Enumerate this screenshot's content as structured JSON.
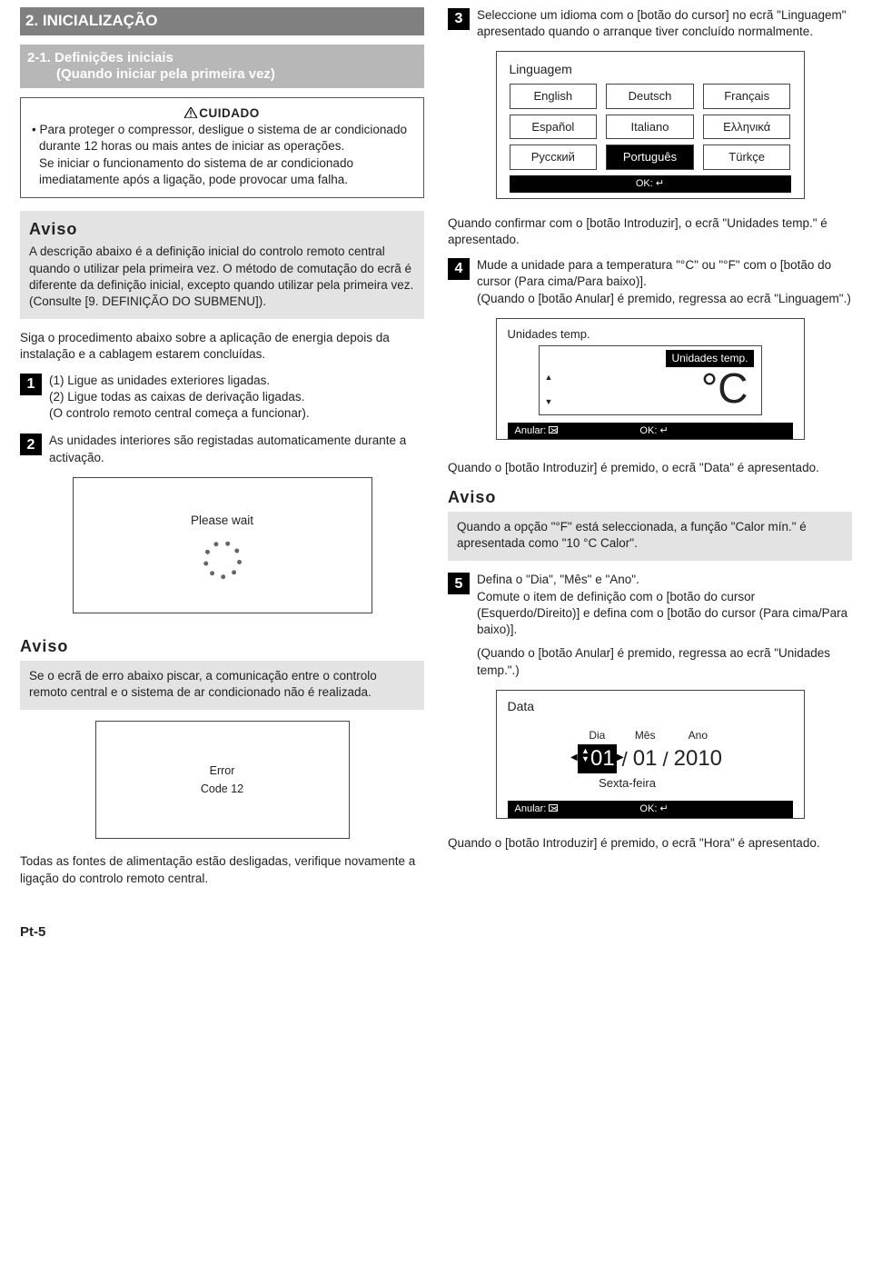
{
  "section": {
    "title": "2. INICIALIZAÇÃO",
    "subtitle_l1": "2-1. Definições iniciais",
    "subtitle_l2": "(Quando iniciar pela primeira vez)"
  },
  "caution": {
    "head": "CUIDADO",
    "p1": "• Para proteger o compressor, desligue o sistema de ar condicionado durante 12 horas ou mais antes de iniciar as operações.",
    "p2": "Se iniciar o funcionamento do sistema de ar condicionado imediatamente após a ligação, pode provocar uma falha."
  },
  "aviso1": {
    "head": "Aviso",
    "body": "A descrição abaixo é a definição inicial do controlo remoto central quando o utilizar pela primeira vez. O método de comutação do ecrã é diferente da definição inicial, excepto quando utilizar pela primeira vez. (Consulte [9. DEFINIÇÃO DO SUBMENU])."
  },
  "intro_follow": "Siga o procedimento abaixo sobre a aplicação de energia depois da instalação e a cablagem estarem concluídas.",
  "step1": {
    "n": "1",
    "l1": "(1) Ligue as unidades exteriores ligadas.",
    "l2": "(2) Ligue todas as caixas de derivação ligadas.",
    "l3": "(O controlo remoto central começa a funcionar)."
  },
  "step2": {
    "n": "2",
    "body": "As unidades interiores são registadas automaticamente durante a activação."
  },
  "wait_screen": {
    "text": "Please wait"
  },
  "aviso2": {
    "head": "Aviso",
    "body": "Se o ecrã de erro abaixo piscar, a comunicação entre o controlo remoto central e o sistema de ar condicionado não é realizada."
  },
  "error_screen": {
    "l1": "Error",
    "l2": "Code 12"
  },
  "after_error": "Todas as fontes de alimentação estão desligadas, verifique novamente a ligação do controlo remoto central.",
  "step3": {
    "n": "3",
    "body": "Seleccione um idioma com o [botão do cursor] no ecrã \"Linguagem\" apresentado quando o arranque tiver concluído normalmente."
  },
  "lang_screen": {
    "title": "Linguagem",
    "opts": [
      "English",
      "Deutsch",
      "Français",
      "Español",
      "Italiano",
      "Ελληνικά",
      "Русский",
      "Português",
      "Türkçe"
    ],
    "ok": "OK:"
  },
  "after_lang": "Quando confirmar com o [botão Introduzir], o ecrã \"Unidades temp.\" é apresentado.",
  "step4": {
    "n": "4",
    "l1": "Mude a unidade para a temperatura \"°C\" ou \"°F\" com o [botão do cursor (Para cima/Para baixo)].",
    "l2": "(Quando o [botão Anular] é premido, regressa ao ecrã \"Linguagem\".)"
  },
  "temp_screen": {
    "outer": "Unidades temp.",
    "inner": "Unidades temp.",
    "value": "°C",
    "cancel": "Anular:",
    "ok": "OK:"
  },
  "after_temp": "Quando o [botão Introduzir] é premido, o ecrã \"Data\" é apresentado.",
  "aviso3": {
    "head": "Aviso",
    "body": "Quando a opção \"°F\" está seleccionada, a função \"Calor mín.\" é apresentada como \"10 °C Calor\"."
  },
  "step5": {
    "n": "5",
    "l1": "Defina o \"Dia\", \"Mês\" e \"Ano\".",
    "l2": "Comute o item de definição com o [botão do cursor (Esquerdo/Direito)] e defina com o [botão do cursor (Para cima/Para baixo)].",
    "l3": "(Quando o [botão Anular] é premido, regressa ao ecrã \"Unidades temp.\".)"
  },
  "date_screen": {
    "title": "Data",
    "day_l": "Dia",
    "mon_l": "Mês",
    "year_l": "Ano",
    "day": "01",
    "mon": "01",
    "year": "2010",
    "weekday": "Sexta-feira",
    "cancel": "Anular:",
    "ok": "OK:"
  },
  "after_date": "Quando o [botão Introduzir] é premido, o ecrã \"Hora\" é apresentado.",
  "page": "Pt-5"
}
